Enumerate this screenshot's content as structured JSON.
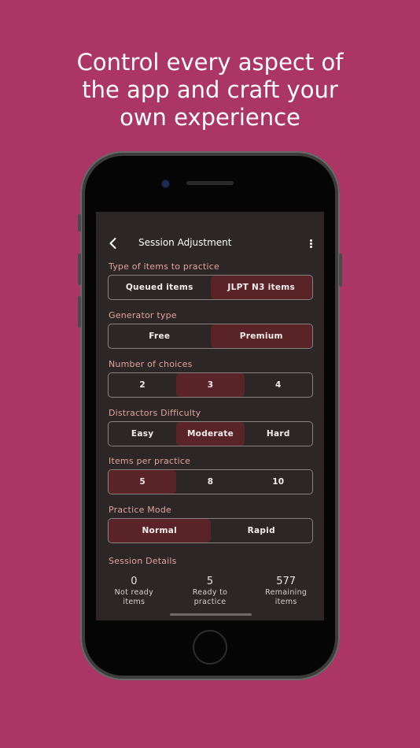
{
  "headline": {
    "line1": "Control every aspect of",
    "line2": "the app and craft your",
    "line3": "own experience"
  },
  "appbar": {
    "title": "Session Adjustment"
  },
  "sections": {
    "type_items": {
      "label": "Type of items to practice",
      "options": [
        "Queued items",
        "JLPT N3 items"
      ],
      "selected": 1
    },
    "generator": {
      "label": "Generator type",
      "options": [
        "Free",
        "Premium"
      ],
      "selected": 1
    },
    "choices": {
      "label": "Number of choices",
      "options": [
        "2",
        "3",
        "4"
      ],
      "selected": 1
    },
    "difficulty": {
      "label": "Distractors Difficulty",
      "options": [
        "Easy",
        "Moderate",
        "Hard"
      ],
      "selected": 1
    },
    "items_per": {
      "label": "Items per practice",
      "options": [
        "5",
        "8",
        "10"
      ],
      "selected": 0
    },
    "mode": {
      "label": "Practice Mode",
      "options": [
        "Normal",
        "Rapid"
      ],
      "selected": 0
    }
  },
  "session_details": {
    "label": "Session Details",
    "stats": [
      {
        "value": "0",
        "line1": "Not ready",
        "line2": "items"
      },
      {
        "value": "5",
        "line1": "Ready to",
        "line2": "practice"
      },
      {
        "value": "577",
        "line1": "Remaining",
        "line2": "items"
      }
    ]
  },
  "colors": {
    "background": "#ab3565",
    "screen": "#2c2626",
    "selected": "#5a2327",
    "label": "#e3a39a"
  },
  "icons": {
    "back": "chevron-left-icon",
    "menu": "more-vertical-icon"
  }
}
